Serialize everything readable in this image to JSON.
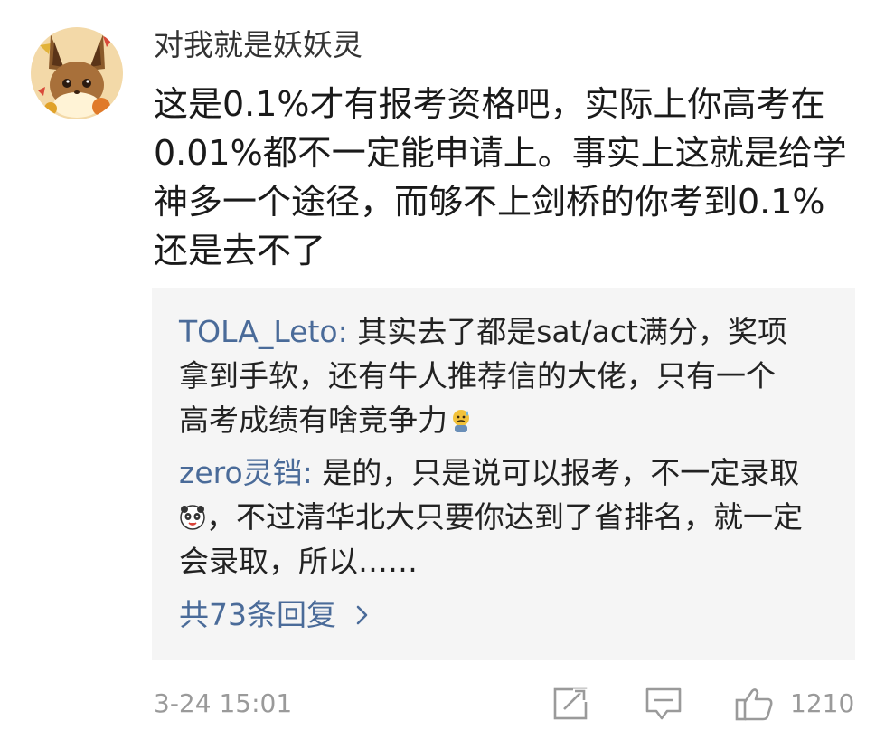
{
  "comment": {
    "username": "对我就是妖妖灵",
    "avatar_icon": "eevee-avatar",
    "text": "这是0.1%才有报考资格吧，实际上你高考在0.01%都不一定能申请上。事实上这就是给学神多一个途径，而够不上剑桥的你考到0.1%还是去不了",
    "timestamp": "3-24 15:01",
    "like_count": "1210"
  },
  "replies": [
    {
      "author": "TOLA_Leto",
      "separator": ": ",
      "text": "其实去了都是sat/act满分，奖项拿到手软，还有牛人推荐信的大佬，只有一个高考成绩有啥竞争力",
      "emoji_icon": "sweat-face-emoji"
    },
    {
      "author": "zero灵铛",
      "separator": ": ",
      "text_before": "是的，只是说可以报考，不一定录取",
      "emoji_icon": "panda-face-emoji",
      "text_after": "，不过清华北大只要你达到了省排名，就一定会录取，所以……"
    }
  ],
  "more_replies_label": "共73条回复",
  "colors": {
    "link": "#4a6b99",
    "meta": "#9a9a9a",
    "reply_bg": "#f5f5f5"
  }
}
